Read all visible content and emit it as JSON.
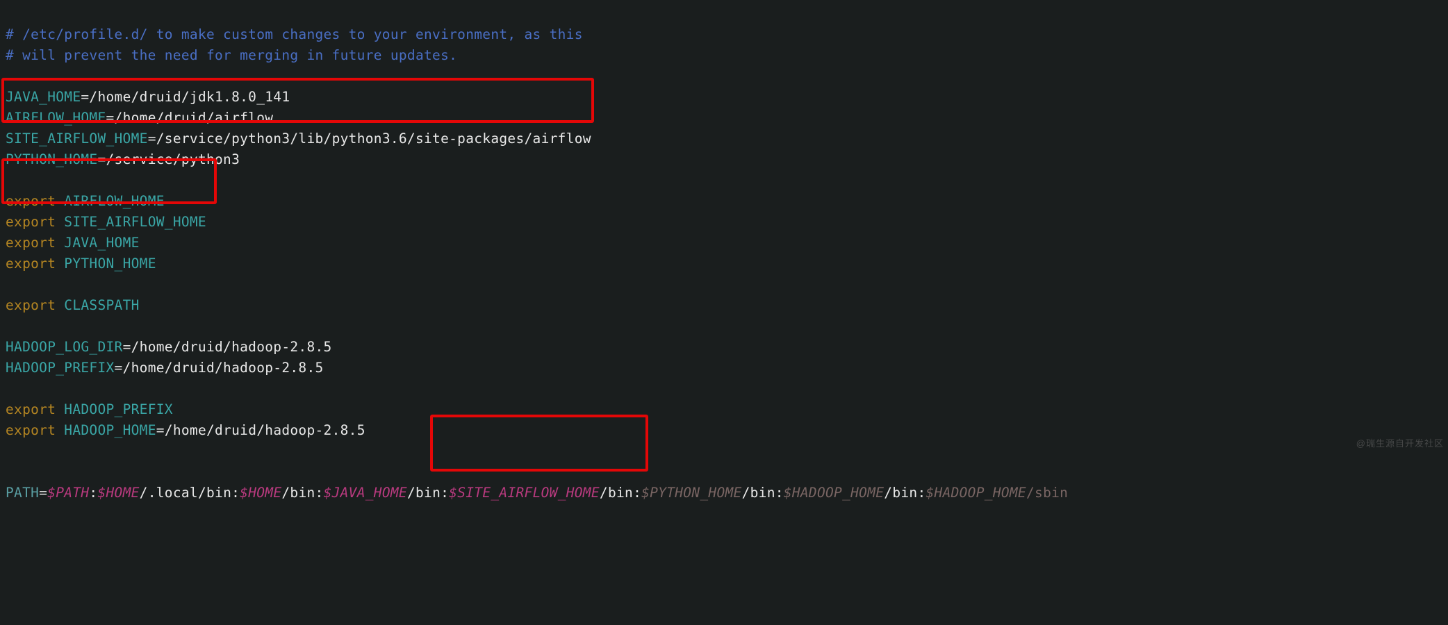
{
  "comments": {
    "c1": "# /etc/profile.d/ to make custom changes to your environment, as this",
    "c2": "# will prevent the need for merging in future updates."
  },
  "vars": {
    "java_home_name": "JAVA_HOME",
    "java_home_val": "/home/druid/jdk1.8.0_141",
    "airflow_home_name": "AIRFLOW_HOME",
    "airflow_home_val": "/home/druid/airflow",
    "site_airflow_name": "SITE_AIRFLOW_HOME",
    "site_airflow_val": "/service/python3/lib/python3.6/site-packages/airflow",
    "python_home_name": "PYTHON_HOME",
    "python_home_val": "/service/python3"
  },
  "exports": {
    "kw": "export",
    "airflow": "AIRFLOW_HOME",
    "site_airflow": "SITE_AIRFLOW_HOME",
    "java": "JAVA_HOME",
    "python": "PYTHON_HOME",
    "classpath": "CLASSPATH",
    "hadoop_prefix": "HADOOP_PREFIX",
    "hadoop_home_name": "HADOOP_HOME",
    "hadoop_home_val": "/home/druid/hadoop-2.8.5"
  },
  "hadoop": {
    "log_dir_name": "HADOOP_LOG_DIR",
    "log_dir_val": "/home/druid/hadoop-2.8.5",
    "prefix_name": "HADOOP_PREFIX",
    "prefix_val": "/home/druid/hadoop-2.8.5"
  },
  "path": {
    "name": "PATH",
    "p_path": "$PATH",
    "colon": ":",
    "p_home1": "$HOME",
    "seg_local": "/.local/bin:",
    "p_home2": "$HOME",
    "seg_bin1": "/bin:",
    "p_java": "$JAVA_HOME",
    "seg_bin2": "/bin:",
    "p_site": "$SITE_AIRFLOW_HOME",
    "seg_bin3": "/bin:",
    "p_python": "$PYTHON_HOME",
    "seg_bin4": "/bin:",
    "p_hadoop": "$HADOOP_HOME",
    "seg_bin5": "/bin:",
    "p_hadoop2_pre": "$HADOOP_",
    "p_hadoop2_suf": "HOME",
    "seg_sbin": "/sbin"
  },
  "equals": "=",
  "watermark": "@瑞生源自开发社区"
}
